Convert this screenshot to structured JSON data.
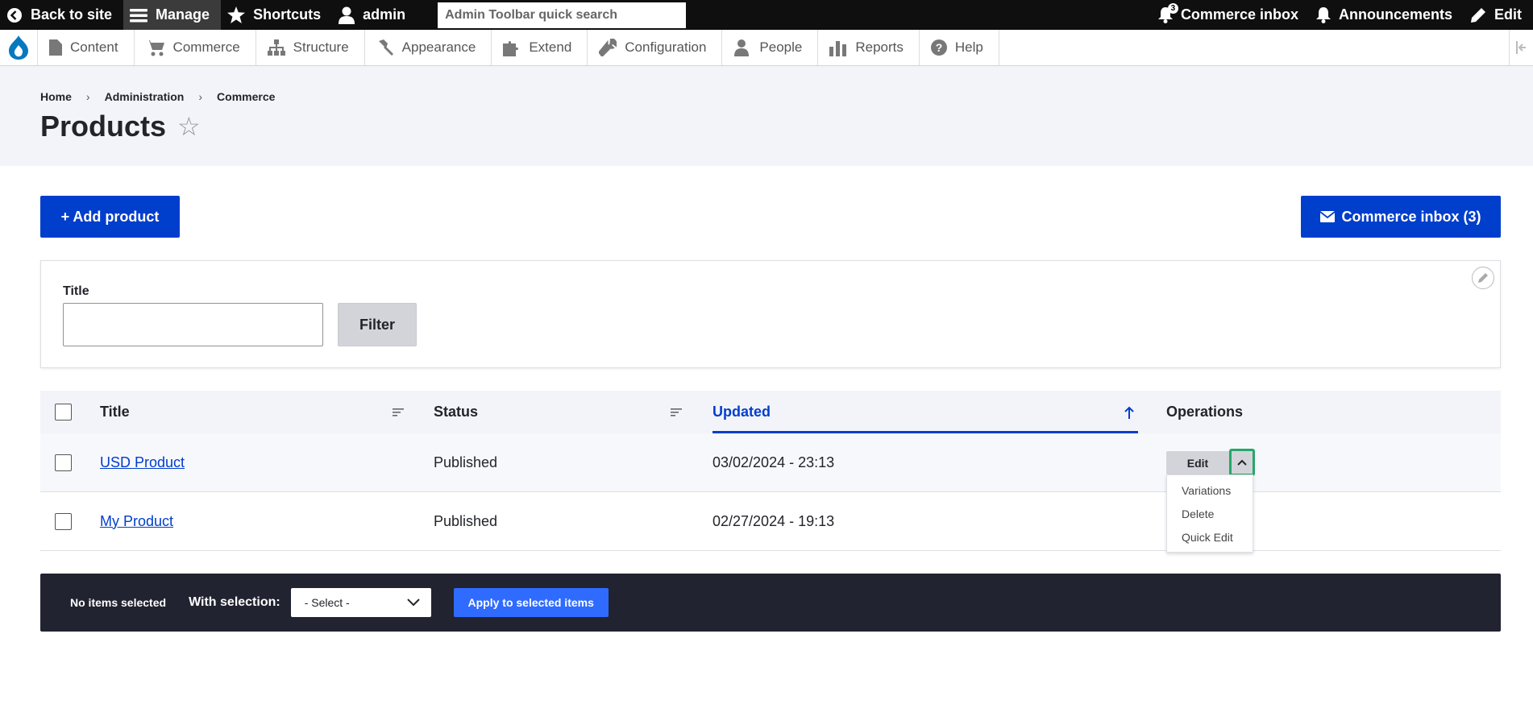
{
  "toolbar": {
    "back_to_site": "Back to site",
    "manage": "Manage",
    "shortcuts": "Shortcuts",
    "user": "admin",
    "search_placeholder": "Admin Toolbar quick search",
    "inbox_label": "Commerce inbox",
    "inbox_count": "3",
    "announcements": "Announcements",
    "edit": "Edit"
  },
  "menu": {
    "items": [
      {
        "label": "Content",
        "icon": "content-icon"
      },
      {
        "label": "Commerce",
        "icon": "cart-icon"
      },
      {
        "label": "Structure",
        "icon": "structure-icon"
      },
      {
        "label": "Appearance",
        "icon": "brush-icon"
      },
      {
        "label": "Extend",
        "icon": "puzzle-icon"
      },
      {
        "label": "Configuration",
        "icon": "wrench-icon"
      },
      {
        "label": "People",
        "icon": "people-icon"
      },
      {
        "label": "Reports",
        "icon": "reports-icon"
      },
      {
        "label": "Help",
        "icon": "help-icon"
      }
    ]
  },
  "breadcrumb": [
    "Home",
    "Administration",
    "Commerce"
  ],
  "page": {
    "title": "Products",
    "add_button": "+ Add product",
    "inbox_button": "Commerce inbox (3)"
  },
  "filter": {
    "title_label": "Title",
    "title_value": "",
    "filter_button": "Filter"
  },
  "table": {
    "headers": {
      "title": "Title",
      "status": "Status",
      "updated": "Updated",
      "operations": "Operations"
    },
    "rows": [
      {
        "title": "USD Product",
        "status": "Published",
        "updated": "03/02/2024 - 23:13"
      },
      {
        "title": "My Product",
        "status": "Published",
        "updated": "02/27/2024 - 19:13"
      }
    ]
  },
  "operations": {
    "edit": "Edit",
    "menu": [
      "Variations",
      "Delete",
      "Quick Edit"
    ]
  },
  "bulk": {
    "no_items": "No items selected",
    "with_selection": "With selection:",
    "select_value": "- Select -",
    "apply": "Apply to selected items"
  },
  "colors": {
    "primary": "#003ecc",
    "toolbar_bg": "#0f0f0f",
    "bulk_bg": "#222330",
    "focus_ring": "#26a769"
  }
}
